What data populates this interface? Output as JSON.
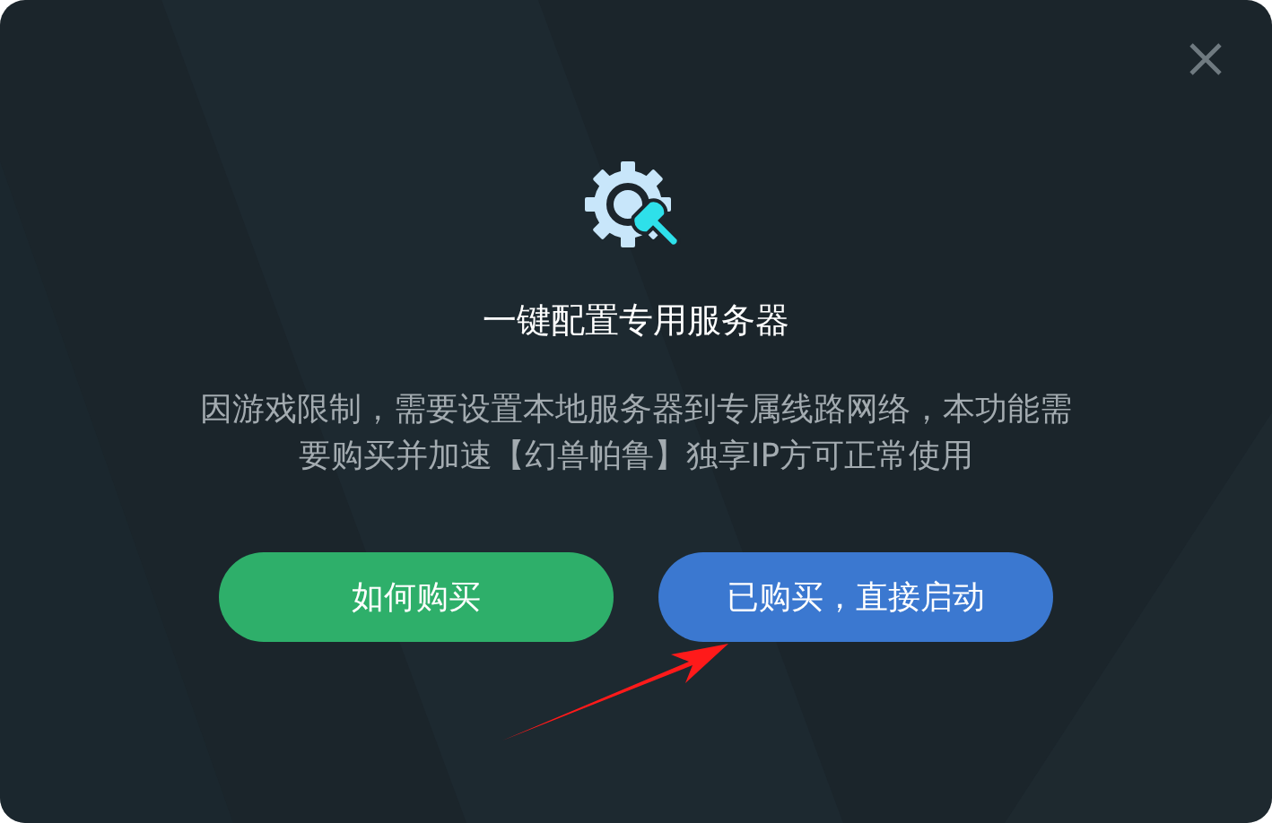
{
  "dialog": {
    "title": "一键配置专用服务器",
    "message": "因游戏限制，需要设置本地服务器到专属线路网络，本功能需要购买并加速【幻兽帕鲁】独享IP方可正常使用",
    "buttons": [
      {
        "label": "如何购买",
        "kind": "secondary"
      },
      {
        "label": "已购买，直接启动",
        "kind": "primary"
      }
    ]
  }
}
